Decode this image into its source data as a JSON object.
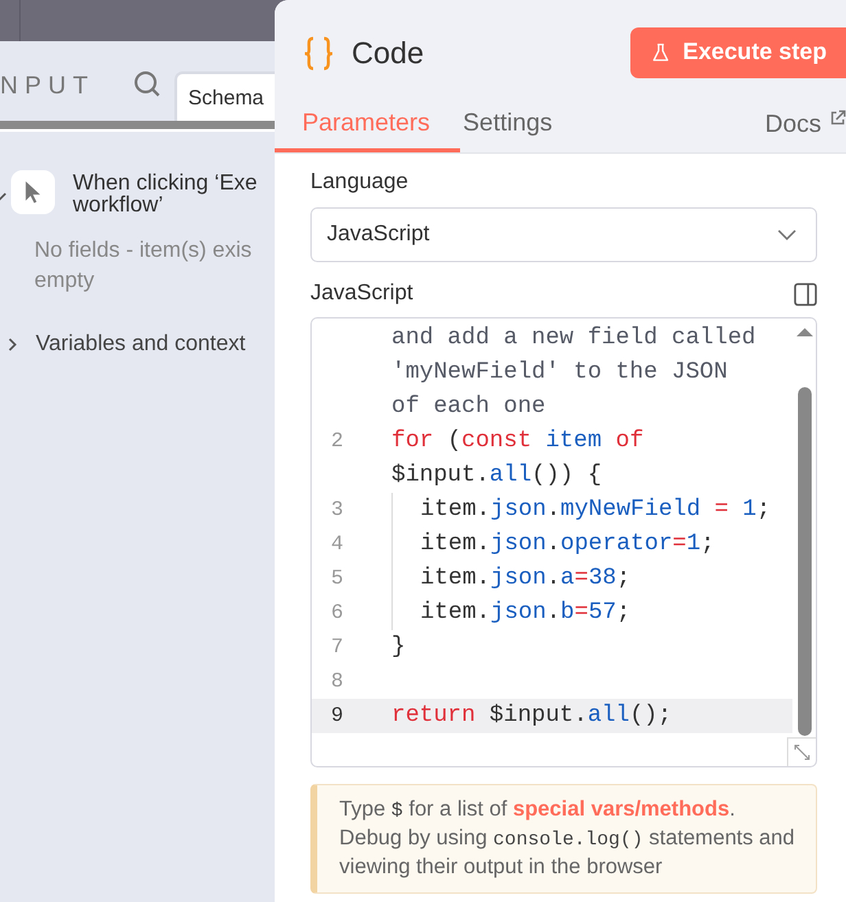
{
  "input_panel": {
    "title": "NPUT",
    "tabs": [
      {
        "label": "Schema",
        "selected": true
      }
    ],
    "tree": [
      {
        "kind": "node",
        "label_lines": [
          "When clicking ‘Exe",
          "workflow’"
        ],
        "expanded": true,
        "note_lines": [
          "No fields - item(s) exis",
          "empty"
        ]
      },
      {
        "kind": "group",
        "label": "Variables and context",
        "expanded": false
      }
    ]
  },
  "node_panel": {
    "title": "Code",
    "button": "Execute step",
    "tabs": [
      {
        "label": "Parameters",
        "selected": true
      },
      {
        "label": "Settings",
        "selected": false
      }
    ],
    "docs_link": "Docs",
    "language": {
      "label": "Language",
      "value": "JavaScript"
    },
    "editor": {
      "label": "JavaScript",
      "lines": [
        {
          "indented": false,
          "active": false,
          "tokens": [
            {
              "kind": "comment",
              "text": "and add a new field called"
            }
          ]
        },
        {
          "indented": false,
          "active": false,
          "tokens": [
            {
              "kind": "comment",
              "text": "'myNewField' to the JSON"
            }
          ]
        },
        {
          "indented": false,
          "active": false,
          "tokens": [
            {
              "kind": "comment",
              "text": "of each one"
            }
          ]
        },
        {
          "number": "2",
          "indented": false,
          "active": false,
          "tokens": [
            {
              "kind": "keyword",
              "text": "for"
            },
            {
              "kind": "plain",
              "text": " ("
            },
            {
              "kind": "keyword",
              "text": "const"
            },
            {
              "kind": "name",
              "text": " item"
            },
            {
              "kind": "keyword",
              "text": " of"
            }
          ]
        },
        {
          "indented": false,
          "active": false,
          "tokens": [
            {
              "kind": "plain",
              "text": "$input."
            },
            {
              "kind": "name",
              "text": "all"
            },
            {
              "kind": "plain",
              "text": "()) {"
            }
          ]
        },
        {
          "number": "3",
          "indented": true,
          "active": false,
          "tokens": [
            {
              "kind": "plain",
              "text": "item."
            },
            {
              "kind": "name",
              "text": "json"
            },
            {
              "kind": "plain",
              "text": "."
            },
            {
              "kind": "name",
              "text": "myNewField"
            },
            {
              "kind": "operator",
              "text": " = "
            },
            {
              "kind": "name",
              "text": "1"
            },
            {
              "kind": "plain",
              "text": ";"
            }
          ]
        },
        {
          "number": "4",
          "indented": true,
          "active": false,
          "tokens": [
            {
              "kind": "plain",
              "text": "item."
            },
            {
              "kind": "name",
              "text": "json"
            },
            {
              "kind": "plain",
              "text": "."
            },
            {
              "kind": "name",
              "text": "operator"
            },
            {
              "kind": "operator",
              "text": "="
            },
            {
              "kind": "name",
              "text": "1"
            },
            {
              "kind": "plain",
              "text": ";"
            }
          ]
        },
        {
          "number": "5",
          "indented": true,
          "active": false,
          "tokens": [
            {
              "kind": "plain",
              "text": "item."
            },
            {
              "kind": "name",
              "text": "json"
            },
            {
              "kind": "plain",
              "text": "."
            },
            {
              "kind": "name",
              "text": "a"
            },
            {
              "kind": "operator",
              "text": "="
            },
            {
              "kind": "name",
              "text": "38"
            },
            {
              "kind": "plain",
              "text": ";"
            }
          ]
        },
        {
          "number": "6",
          "indented": true,
          "active": false,
          "tokens": [
            {
              "kind": "plain",
              "text": "item."
            },
            {
              "kind": "name",
              "text": "json"
            },
            {
              "kind": "plain",
              "text": "."
            },
            {
              "kind": "name",
              "text": "b"
            },
            {
              "kind": "operator",
              "text": "="
            },
            {
              "kind": "name",
              "text": "57"
            },
            {
              "kind": "plain",
              "text": ";"
            }
          ]
        },
        {
          "number": "7",
          "indented": false,
          "active": false,
          "tokens": [
            {
              "kind": "plain",
              "text": "}"
            }
          ]
        },
        {
          "number": "8",
          "indented": false,
          "active": false
        },
        {
          "number": "9",
          "indented": false,
          "active": true,
          "tokens": [
            {
              "kind": "keyword",
              "text": "return"
            },
            {
              "kind": "plain",
              "text": " $input."
            },
            {
              "kind": "name",
              "text": "all"
            },
            {
              "kind": "plain",
              "text": "();"
            }
          ]
        }
      ]
    },
    "tip": [
      {
        "kind": "text",
        "text": "Type "
      },
      {
        "kind": "code",
        "text": "$"
      },
      {
        "kind": "text",
        "text": " for a list of "
      },
      {
        "kind": "link",
        "text": "special vars/methods"
      },
      {
        "kind": "text",
        "text": ". Debug by using "
      },
      {
        "kind": "code",
        "text": "console.log()"
      },
      {
        "kind": "text",
        "text": " statements and viewing their output in the browser"
      }
    ]
  }
}
